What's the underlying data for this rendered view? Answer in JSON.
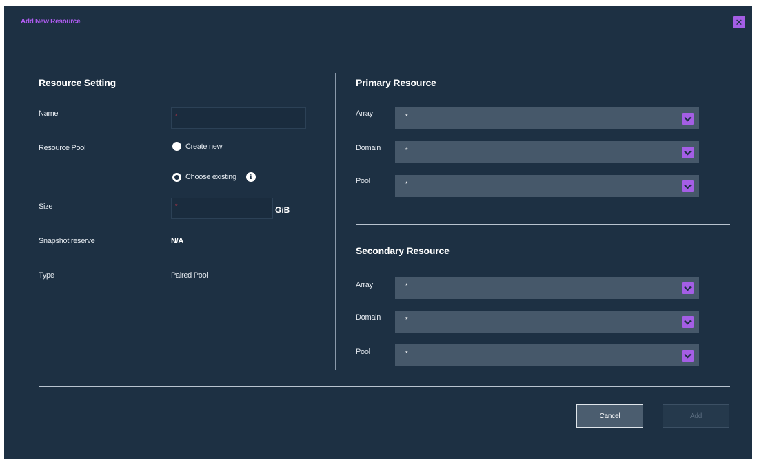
{
  "dialog": {
    "title": "Add New Resource",
    "close_icon": "close-icon",
    "accent_color": "#a45ee5"
  },
  "resource_setting": {
    "heading": "Resource Setting",
    "name_label": "Name",
    "name_value": "",
    "required_mark": "*",
    "pool_label": "Resource Pool",
    "pool_options": [
      "Create new",
      "Choose existing"
    ],
    "pool_selected": "Create new",
    "info_icon": "info-icon",
    "size_label": "Size",
    "size_value": "",
    "size_unit": "GiB",
    "snapshot_label": "Snapshot reserve",
    "snapshot_value": "N/A",
    "type_label": "Type",
    "type_value": "Paired Pool"
  },
  "primary": {
    "heading": "Primary Resource",
    "fields": [
      {
        "label": "Array",
        "value": "*"
      },
      {
        "label": "Domain",
        "value": "*"
      },
      {
        "label": "Pool",
        "value": "*"
      }
    ]
  },
  "secondary": {
    "heading": "Secondary Resource",
    "fields": [
      {
        "label": "Array",
        "value": "*"
      },
      {
        "label": "Domain",
        "value": "*"
      },
      {
        "label": "Pool",
        "value": "*"
      }
    ]
  },
  "actions": {
    "cancel_label": "Cancel",
    "add_label": "Add",
    "add_enabled": false
  }
}
